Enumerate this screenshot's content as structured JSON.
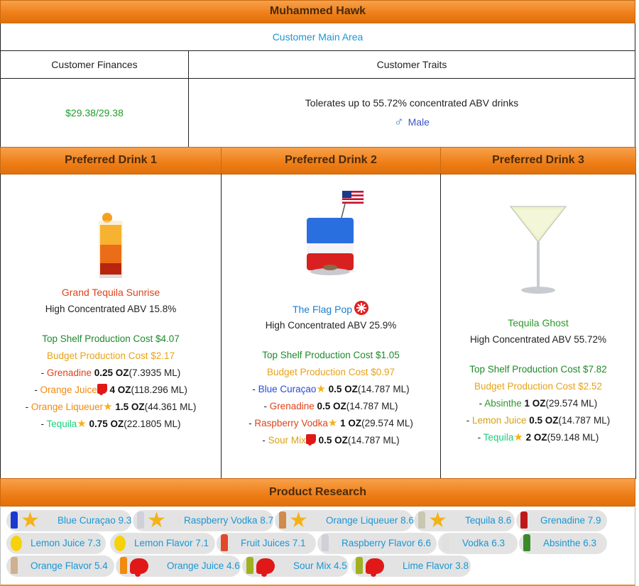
{
  "customer_name": "Muhammed Hawk",
  "main_area_link": "Customer Main Area",
  "finances": {
    "heading": "Customer Finances",
    "money": "$29.38/29.38"
  },
  "traits": {
    "heading": "Customer Traits",
    "abv_text": "Tolerates up to 55.72% concentrated ABV drinks",
    "gender_icon": "male-symbol-icon",
    "gender": "Male"
  },
  "drinks": [
    {
      "heading": "Preferred Drink 1",
      "name": "Grand Tequila Sunrise",
      "name_color": "#e0421a",
      "abv": "High Concentrated ABV 15.8%",
      "top_cost": "Top Shelf Production Cost $4.07",
      "budget_cost": "Budget Production Cost $2.17",
      "ingredients": [
        {
          "name": "Grenadine",
          "color": "#e0421a",
          "mark": "",
          "amount": "0.25 OZ",
          "ml": "(7.3935 ML)"
        },
        {
          "name": "Orange Juice",
          "color": "#f08a10",
          "mark": "dislike",
          "amount": "4 OZ",
          "ml": "(118.296 ML)"
        },
        {
          "name": "Orange Liqueuer",
          "color": "#f08a10",
          "mark": "star",
          "amount": "1.5 OZ",
          "ml": "(44.361 ML)"
        },
        {
          "name": "Tequila",
          "color": "#1ad07a",
          "mark": "star",
          "amount": "0.75 OZ",
          "ml": "(22.1805 ML)"
        }
      ]
    },
    {
      "heading": "Preferred Drink 2",
      "name": "The Flag Pop",
      "name_color": "#1a7fd0",
      "abv": "High Concentrated ABV 25.9%",
      "top_cost": "Top Shelf Production Cost $1.05",
      "budget_cost": "Budget Production Cost $0.97",
      "ingredients": [
        {
          "name": "Blue Curaçao",
          "color": "#2a4ad8",
          "mark": "star",
          "amount": "0.5 OZ",
          "ml": "(14.787 ML)"
        },
        {
          "name": "Grenadine",
          "color": "#e0421a",
          "mark": "",
          "amount": "0.5 OZ",
          "ml": "(14.787 ML)"
        },
        {
          "name": "Raspberry Vodka",
          "color": "#e0421a",
          "mark": "star",
          "amount": "1 OZ",
          "ml": "(29.574 ML)"
        },
        {
          "name": "Sour Mix",
          "color": "#d9a010",
          "mark": "dislike",
          "amount": "0.5 OZ",
          "ml": "(14.787 ML)"
        }
      ]
    },
    {
      "heading": "Preferred Drink 3",
      "name": "Tequila Ghost",
      "name_color": "#2a9a2a",
      "abv": "High Concentrated ABV 55.72%",
      "top_cost": "Top Shelf Production Cost $7.82",
      "budget_cost": "Budget Production Cost $2.52",
      "ingredients": [
        {
          "name": "Absinthe",
          "color": "#2a9a2a",
          "mark": "",
          "amount": "1 OZ",
          "ml": "(29.574 ML)"
        },
        {
          "name": "Lemon Juice",
          "color": "#d9a010",
          "mark": "",
          "amount": "0.5 OZ",
          "ml": "(14.787 ML)"
        },
        {
          "name": "Tequila",
          "color": "#1ad07a",
          "mark": "star",
          "amount": "2 OZ",
          "ml": "(59.148 ML)"
        }
      ]
    }
  ],
  "product_research": {
    "heading": "Product Research",
    "items": [
      {
        "label": "Blue Curaçao 9.3",
        "mark": "star",
        "bottle": "#1a3ad0"
      },
      {
        "label": "Raspberry Vodka 8.7",
        "mark": "star",
        "bottle": "#d0d0d8"
      },
      {
        "label": "Orange Liqueuer 8.6",
        "mark": "star",
        "bottle": "#d08a4a"
      },
      {
        "label": "Tequila 8.6",
        "mark": "star",
        "bottle": "#c8c8b0"
      },
      {
        "label": "Grenadine 7.9",
        "mark": "",
        "bottle": "#c01818"
      },
      {
        "label": "Lemon Juice 7.3",
        "mark": "",
        "bottle": "lemon"
      },
      {
        "label": "Lemon Flavor 7.1",
        "mark": "",
        "bottle": "lemon"
      },
      {
        "label": "Fruit Juices 7.1",
        "mark": "",
        "bottle": "#e04a2a"
      },
      {
        "label": "Raspberry Flavor 6.6",
        "mark": "",
        "bottle": "#d0d0d8"
      },
      {
        "label": "Vodka 6.3",
        "mark": "",
        "bottle": "#e0e0e0"
      },
      {
        "label": "Absinthe 6.3",
        "mark": "",
        "bottle": "#3a8a2a"
      },
      {
        "label": "Orange Flavor 5.4",
        "mark": "",
        "bottle": "#d0b090"
      },
      {
        "label": "Orange Juice 4.6",
        "mark": "dislike",
        "bottle": "#f08a10"
      },
      {
        "label": "Sour Mix 4.5",
        "mark": "dislike",
        "bottle": "#a0b020"
      },
      {
        "label": "Lime Flavor 3.8",
        "mark": "dislike",
        "bottle": "#a0b020"
      }
    ]
  }
}
